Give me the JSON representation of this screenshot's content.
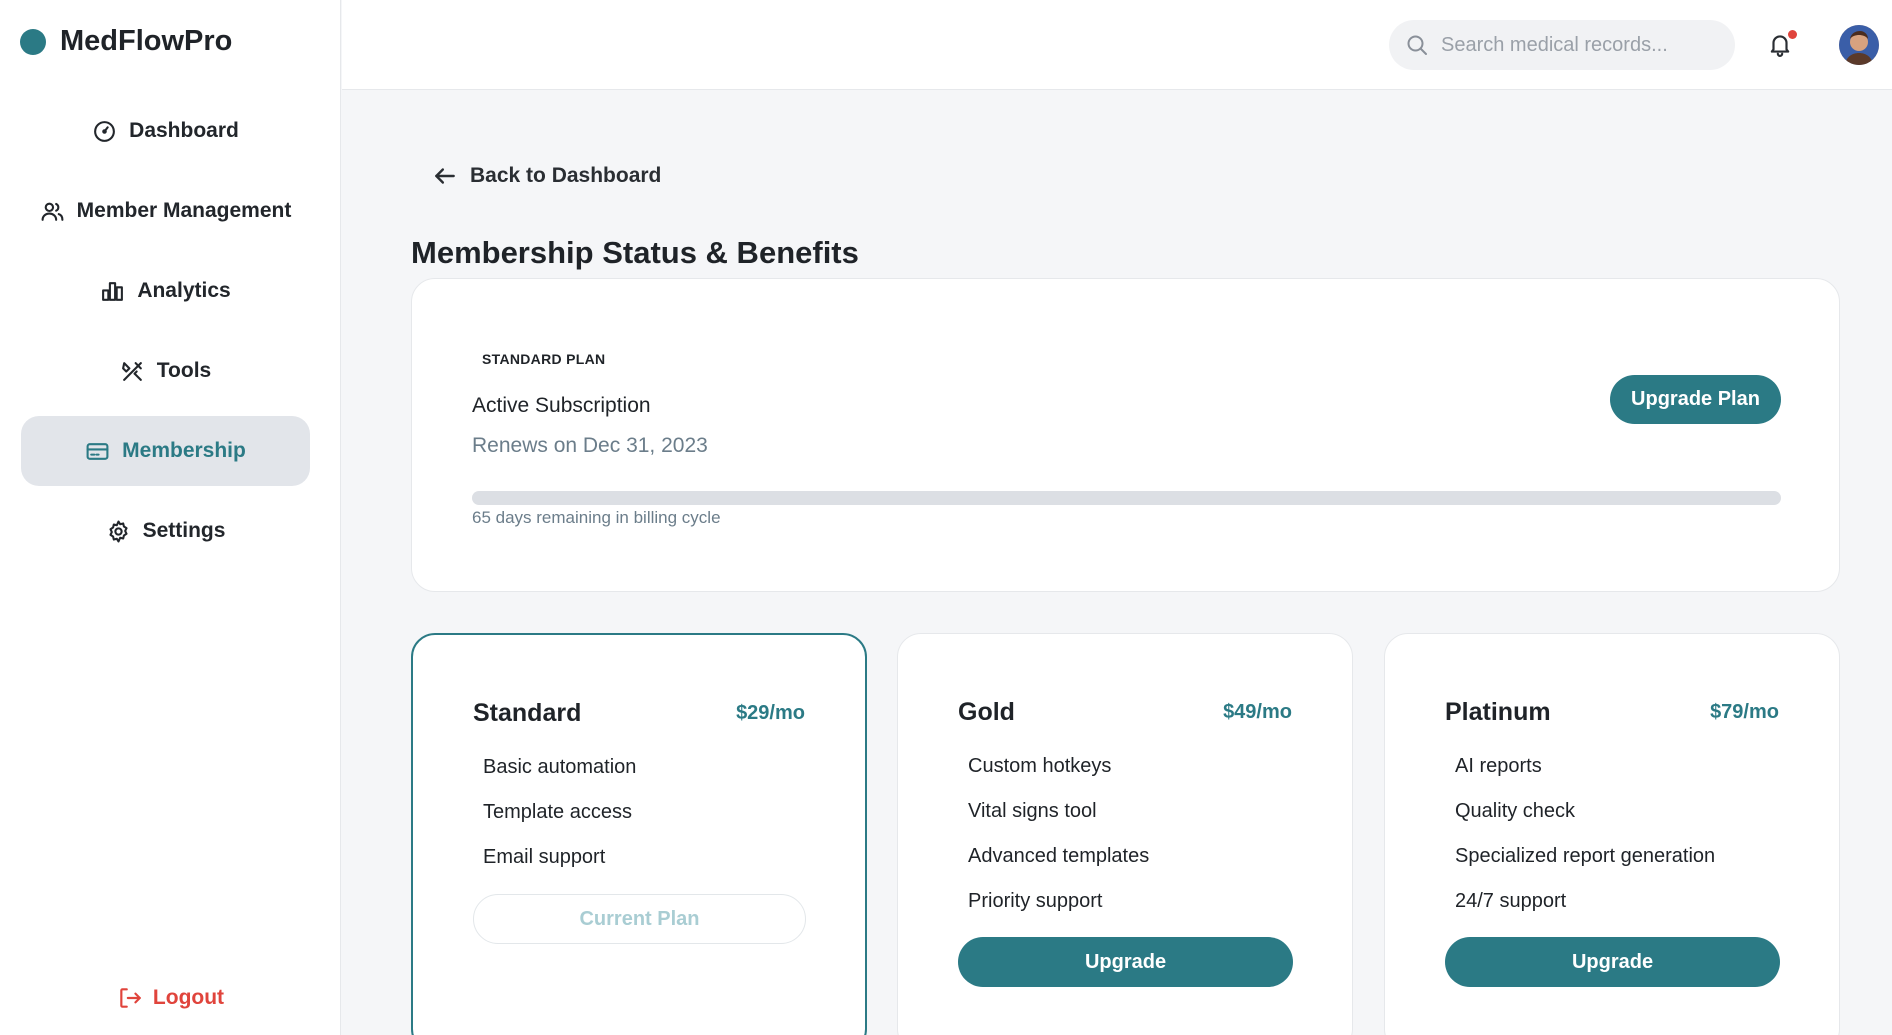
{
  "app": {
    "name": "MedFlowPro"
  },
  "sidebar": {
    "items": [
      {
        "label": "Dashboard",
        "icon": "gauge-icon"
      },
      {
        "label": "Member Management",
        "icon": "users-icon"
      },
      {
        "label": "Analytics",
        "icon": "bar-chart-icon"
      },
      {
        "label": "Tools",
        "icon": "tools-icon"
      },
      {
        "label": "Membership",
        "icon": "credit-card-icon",
        "active": true
      },
      {
        "label": "Settings",
        "icon": "gear-icon"
      }
    ],
    "logout_label": "Logout"
  },
  "topbar": {
    "search": {
      "placeholder": "Search medical records...",
      "value": ""
    },
    "notifications": {
      "has_unread": true
    }
  },
  "main": {
    "back_label": "Back to Dashboard",
    "title": "Membership Status & Benefits",
    "status": {
      "plan_tag": "STANDARD PLAN",
      "state": "Active Subscription",
      "renews": "Renews on Dec 31, 2023",
      "upgrade_label": "Upgrade Plan",
      "progress_fraction": 0,
      "progress_text": "65 days remaining in billing cycle"
    },
    "plans": [
      {
        "name": "Standard",
        "price": "$29/mo",
        "features": [
          "Basic automation",
          "Template access",
          "Email support"
        ],
        "button": "Current Plan",
        "current": true
      },
      {
        "name": "Gold",
        "price": "$49/mo",
        "features": [
          "Custom hotkeys",
          "Vital signs tool",
          "Advanced templates",
          "Priority support"
        ],
        "button": "Upgrade",
        "current": false
      },
      {
        "name": "Platinum",
        "price": "$79/mo",
        "features": [
          "AI reports",
          "Quality check",
          "Specialized report generation",
          "24/7 support"
        ],
        "button": "Upgrade",
        "current": false
      }
    ]
  },
  "colors": {
    "accent": "#2b7a85",
    "danger": "#e0443c",
    "active_bg": "#e2e5ea"
  }
}
